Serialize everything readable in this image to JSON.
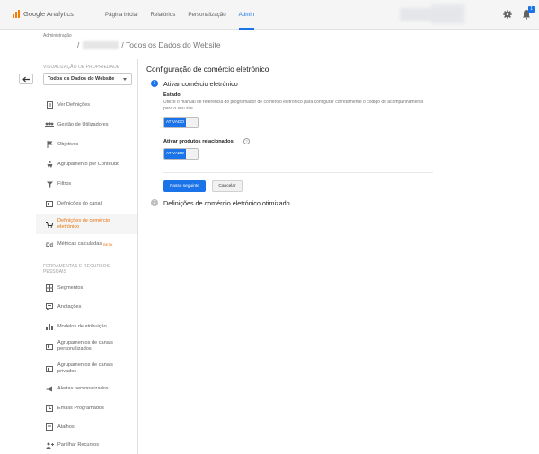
{
  "app": {
    "name": "Google Analytics"
  },
  "nav": {
    "items": [
      {
        "label": "Página inicial"
      },
      {
        "label": "Relatórios"
      },
      {
        "label": "Personalização"
      },
      {
        "label": "Admin",
        "active": true
      }
    ]
  },
  "header": {
    "notification_count": "1"
  },
  "breadcrumb": {
    "small": "Administração",
    "separator": "/",
    "property": "/ Todos os Dados do Website"
  },
  "sidebar": {
    "section_property": "VISUALIZAÇÃO DE PROPRIEDADE",
    "selected_view": "Todos os Dados do Website",
    "items": [
      {
        "label": "Ver Definições",
        "icon": "document-icon"
      },
      {
        "label": "Gestão de Utilizadores",
        "icon": "users-icon"
      },
      {
        "label": "Objetivos",
        "icon": "flag-icon"
      },
      {
        "label": "Agrupamento por Conteúdo",
        "icon": "person-icon"
      },
      {
        "label": "Filtros",
        "icon": "filter-icon"
      },
      {
        "label": "Definições do canal",
        "icon": "channel-icon"
      },
      {
        "label": "Definições de comércio eletrónico",
        "icon": "cart-icon",
        "active": true
      },
      {
        "label": "Métricas calculadas",
        "badge": "BETA",
        "icon": "dd-icon"
      }
    ],
    "section_tools": "FERRAMENTAS E RECURSOS PESSOAIS",
    "tools": [
      {
        "label": "Segmentos",
        "icon": "segments-icon"
      },
      {
        "label": "Anotações",
        "icon": "annotation-icon"
      },
      {
        "label": "Modelos de atribuição",
        "icon": "bar-chart-icon"
      },
      {
        "label": "Agrupamentos de canais personalizados",
        "icon": "channel-icon"
      },
      {
        "label": "Agrupamentos de canais privados",
        "icon": "channel-icon"
      },
      {
        "label": "Alertas personalizados",
        "icon": "megaphone-icon"
      },
      {
        "label": "Emails Programados",
        "icon": "clock-icon"
      },
      {
        "label": "Atalhos",
        "icon": "shortcut-icon"
      },
      {
        "label": "Partilhar Recursos",
        "icon": "share-user-icon"
      }
    ]
  },
  "main": {
    "title": "Configuração de comércio eletrónico",
    "step1": {
      "number": "1",
      "title": "Ativar comércio eletrónico",
      "status_label": "Estado",
      "description": "Utilize o manual de referência do programador de comércio eletrónico para configurar corretamente o código de acompanhamento para o seu site.",
      "status_toggle": "ATIVADO",
      "related_label": "Ativar produtos relacionados",
      "related_toggle": "ATIVADO",
      "help": "?"
    },
    "buttons": {
      "next": "Passo seguinte",
      "cancel": "Cancelar"
    },
    "step2": {
      "number": "2",
      "title": "Definições de comércio eletrónico otimizado"
    }
  },
  "colors": {
    "accent": "#1a73e8",
    "active_sidebar": "#e8710a",
    "logo": "#f57c00"
  }
}
